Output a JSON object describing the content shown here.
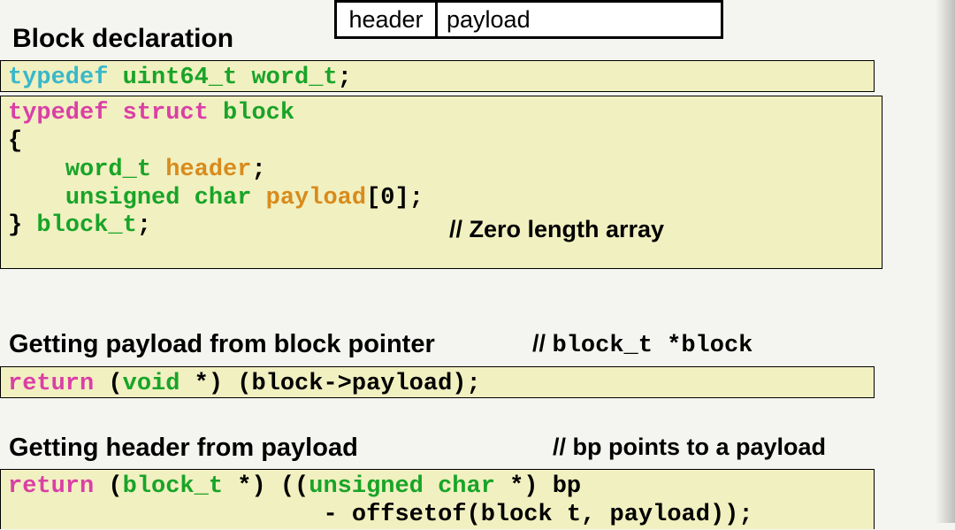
{
  "diagram": {
    "header": "header",
    "payload": "payload"
  },
  "sections": {
    "block_declaration": "Block declaration",
    "getting_payload": "Getting payload from block pointer",
    "getting_header": "Getting header from payload"
  },
  "comments": {
    "zero_length": "// Zero length array",
    "block_ptr_prefix": "// ",
    "block_ptr_code": "block_t *block",
    "bp_payload": "// bp points to a payload"
  },
  "code": {
    "typedef_word": {
      "typedef": "typedef",
      "uint64": "uint64_t",
      "word": "word_t",
      "semi": ";"
    },
    "struct_block": {
      "typedef": "typedef",
      "struct": "struct",
      "block": "block",
      "lbrace": "{",
      "indent": "    ",
      "word_t": "word_t",
      "header": "header",
      "semi1": ";",
      "unsigned_char": "unsigned char",
      "payload": "payload",
      "bracket": "[0]",
      "semi2": ";",
      "rbrace": "}",
      "block_t": "block_t",
      "semi3": ";"
    },
    "get_payload": {
      "return": "return",
      "void_star": "(void *)",
      "expr": " (block->payload);",
      "void_l": "(",
      "void_kw": "void",
      "void_star_r": " *)"
    },
    "get_header": {
      "return": "return",
      "block_t_l": "(",
      "block_t": "block_t",
      "block_t_r": " *)",
      "cast_l": " ((",
      "unsigned_char": "unsigned char",
      "cast_r": " *) bp",
      "line2_indent": "                      ",
      "minus": "- ",
      "offsetof": "offsetof",
      "args": "(block_t, payload));",
      "arg_l": "(block t, payload));"
    }
  }
}
